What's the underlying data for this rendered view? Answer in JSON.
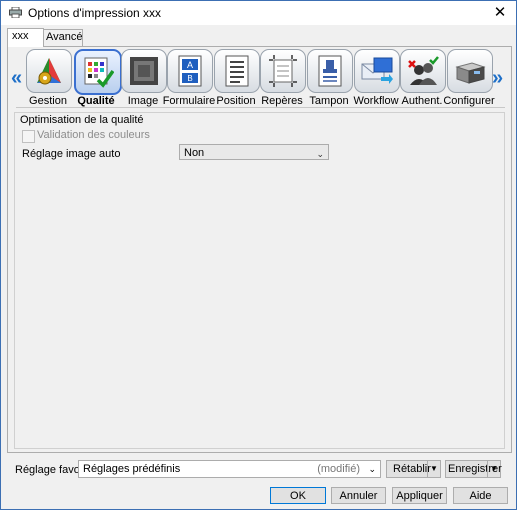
{
  "window": {
    "title": "Options d'impression xxx",
    "close_glyph": "✕"
  },
  "tabs": [
    {
      "label": "xxx"
    },
    {
      "label": "Avancé"
    }
  ],
  "nav": {
    "prev_glyph": "«",
    "next_glyph": "»"
  },
  "categories": [
    {
      "label": "Gestion",
      "icon": "gestion-icon"
    },
    {
      "label": "Qualité",
      "icon": "quality-icon",
      "selected": true
    },
    {
      "label": "Image",
      "icon": "image-icon"
    },
    {
      "label": "Formulaire",
      "icon": "form-icon"
    },
    {
      "label": "Position",
      "icon": "position-icon"
    },
    {
      "label": "Repères",
      "icon": "marks-icon"
    },
    {
      "label": "Tampon",
      "icon": "stamp-icon"
    },
    {
      "label": "Workflow",
      "icon": "workflow-icon"
    },
    {
      "label": "Authent.",
      "icon": "auth-icon"
    },
    {
      "label": "Configurer",
      "icon": "configure-icon"
    }
  ],
  "quality": {
    "group_title": "Optimisation de la qualité",
    "color_validation_label": "Validation des couleurs",
    "color_validation_checked": false,
    "auto_image_label": "Réglage image auto",
    "auto_image_value": "Non"
  },
  "favorite": {
    "label": "Réglage favori",
    "value": "Réglages prédéfinis",
    "modified": "(modifié)",
    "reset_label": "Rétablir",
    "save_label": "Enregistrer"
  },
  "buttons": {
    "ok": "OK",
    "cancel": "Annuler",
    "apply": "Appliquer",
    "help": "Aide"
  }
}
